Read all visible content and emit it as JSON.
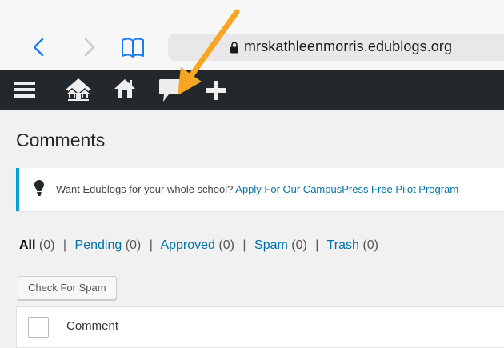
{
  "browser": {
    "url": "mrskathleenmorris.edublogs.org",
    "icons": [
      "back-chevron-icon",
      "forward-chevron-icon",
      "bookmarks-book-icon",
      "lock-icon"
    ]
  },
  "admin_bar": {
    "icons": [
      "menu-icon",
      "my-sites-icon",
      "home-icon",
      "comments-icon",
      "new-content-plus-icon"
    ],
    "background": "#23282d"
  },
  "page": {
    "title": "Comments"
  },
  "notice": {
    "text": "Want Edublogs for your whole school?",
    "link": "Apply For Our CampusPress Free Pilot Program",
    "accent": "#00a0d2"
  },
  "filters": {
    "all": {
      "label": "All",
      "count": "(0)"
    },
    "pending": {
      "label": "Pending",
      "count": "(0)"
    },
    "approved": {
      "label": "Approved",
      "count": "(0)"
    },
    "spam": {
      "label": "Spam",
      "count": "(0)"
    },
    "trash": {
      "label": "Trash",
      "count": "(0)"
    },
    "separator": "|"
  },
  "toolbar": {
    "check_spam_label": "Check For Spam"
  },
  "table": {
    "columns": [
      "Comment"
    ]
  },
  "annotation": {
    "arrow_color": "#f5a623"
  }
}
